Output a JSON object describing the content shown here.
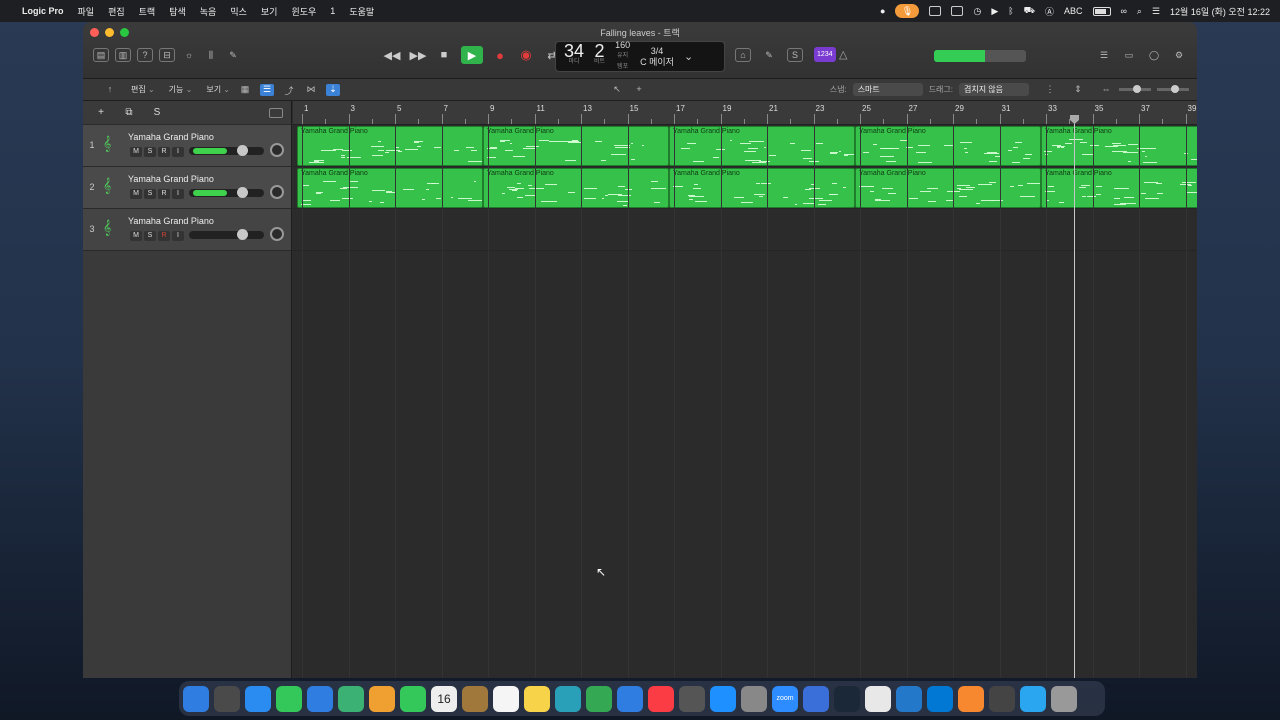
{
  "menubar": {
    "app_name": "Logic Pro",
    "items": [
      "파일",
      "편집",
      "트랙",
      "탐색",
      "녹음",
      "믹스",
      "보기",
      "윈도우",
      "1",
      "도움말"
    ],
    "input_label": "ABC",
    "datetime": "12월 16일 (화) 오전 12:22"
  },
  "window": {
    "title": "Falling leaves - 트랙",
    "lcd": {
      "bar": "34",
      "beat": "2",
      "bar_label": "마디",
      "beat_label": "비트",
      "tempo": "160",
      "tempo_sub": "유지",
      "tempo_label": "템포",
      "signature": "3/4",
      "key": "C 메이저"
    },
    "counter_badge": "1234",
    "meter_level": 0.55,
    "toolbar": {
      "edit": "편집",
      "functions": "기능",
      "view": "보기",
      "snap_label": "스냅:",
      "snap_value": "스마트",
      "drag_label": "드래그:",
      "drag_value": "겹치지 않음"
    }
  },
  "header_tools": {
    "add": "+",
    "solo": "S"
  },
  "tracks": [
    {
      "number": "1",
      "name": "Yamaha Grand Piano",
      "m": "M",
      "s": "S",
      "r": "R",
      "i": "I",
      "volume": 0.72
    },
    {
      "number": "2",
      "name": "Yamaha Grand Piano",
      "m": "M",
      "s": "S",
      "r": "R",
      "i": "I",
      "volume": 0.72
    },
    {
      "number": "3",
      "name": "Yamaha Grand Piano",
      "m": "M",
      "s": "S",
      "r": "R",
      "i": "I",
      "volume": 0.72
    }
  ],
  "ruler": {
    "bars": [
      "1",
      "3",
      "5",
      "7",
      "9",
      "11",
      "13",
      "15",
      "17",
      "19",
      "21",
      "23",
      "25",
      "27",
      "29",
      "31",
      "33",
      "35",
      "37",
      "39"
    ]
  },
  "region_label": "Yamaha Grand Piano",
  "colors": {
    "region": "#36c24a",
    "play": "#2fb34a",
    "record": "#e23b3b",
    "accent": "#3b82d6",
    "badge": "#7a3bd0"
  },
  "dock": {
    "calendar_day": "16",
    "zoom_label": "zoom",
    "icons": [
      "finder-icon",
      "launchpad-icon",
      "safari-icon",
      "messages-icon",
      "mail-icon",
      "maps-icon",
      "photos-icon",
      "facetime-icon",
      "calendar-icon",
      "contacts-icon",
      "reminders-icon",
      "notes-icon",
      "freeform-icon",
      "numbers-icon",
      "keynote-icon",
      "music-icon",
      "screenshot-icon",
      "app-store-icon",
      "settings-icon",
      "zoom-icon",
      "preview-icon",
      "steam-icon",
      "play-icon",
      "remote-icon",
      "windows-icon",
      "pages-icon",
      "logic-icon",
      "quicktime-icon",
      "trash-icon"
    ]
  }
}
